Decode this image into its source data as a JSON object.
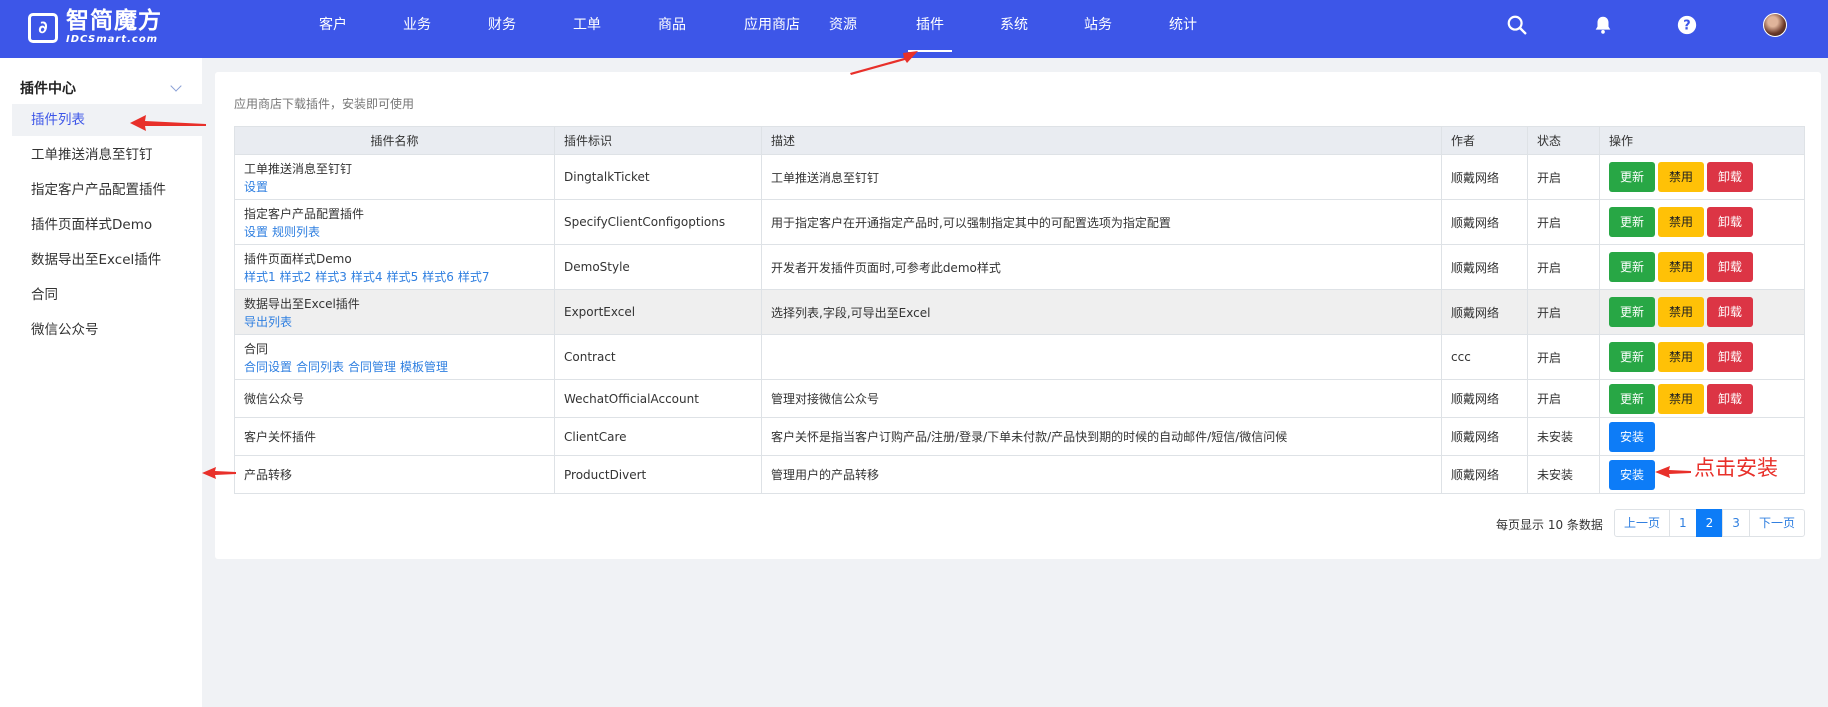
{
  "header": {
    "logo_cn": "智简魔方",
    "logo_en": "IDCSmart.com",
    "nav": [
      {
        "label": "客户"
      },
      {
        "label": "业务"
      },
      {
        "label": "财务"
      },
      {
        "label": "工单"
      },
      {
        "label": "商品"
      },
      {
        "label": "应用商店"
      },
      {
        "label": "资源"
      },
      {
        "label": "插件"
      },
      {
        "label": "系统"
      },
      {
        "label": "站务"
      },
      {
        "label": "统计"
      }
    ],
    "active_nav": "插件",
    "icons": [
      "search-icon",
      "bell-icon",
      "help-icon",
      "user-avatar"
    ]
  },
  "sidebar": {
    "section_title": "插件中心",
    "items": [
      {
        "label": "插件列表"
      },
      {
        "label": "工单推送消息至钉钉"
      },
      {
        "label": "指定客户产品配置插件"
      },
      {
        "label": "插件页面样式Demo"
      },
      {
        "label": "数据导出至Excel插件"
      },
      {
        "label": "合同"
      },
      {
        "label": "微信公众号"
      }
    ],
    "active_item": "插件列表"
  },
  "main": {
    "hint": "应用商店下载插件，安装即可使用",
    "columns": [
      "插件名称",
      "插件标识",
      "描述",
      "作者",
      "状态",
      "操作"
    ],
    "rows": [
      {
        "name": "工单推送消息至钉钉",
        "links": [
          "设置"
        ],
        "id": "DingtalkTicket",
        "desc": "工单推送消息至钉钉",
        "author": "顺戴网络",
        "status": "开启",
        "actions": [
          "更新",
          "禁用",
          "卸载"
        ]
      },
      {
        "name": "指定客户产品配置插件",
        "links": [
          "设置",
          "规则列表"
        ],
        "id": "SpecifyClientConfigoptions",
        "desc": "用于指定客户在开通指定产品时,可以强制指定其中的可配置选项为指定配置",
        "author": "顺戴网络",
        "status": "开启",
        "actions": [
          "更新",
          "禁用",
          "卸载"
        ]
      },
      {
        "name": "插件页面样式Demo",
        "links": [
          "样式1",
          "样式2",
          "样式3",
          "样式4",
          "样式5",
          "样式6",
          "样式7"
        ],
        "id": "DemoStyle",
        "desc": "开发者开发插件页面时,可参考此demo样式",
        "author": "顺戴网络",
        "status": "开启",
        "actions": [
          "更新",
          "禁用",
          "卸载"
        ]
      },
      {
        "name": "数据导出至Excel插件",
        "links": [
          "导出列表"
        ],
        "id": "ExportExcel",
        "desc": "选择列表,字段,可导出至Excel",
        "author": "顺戴网络",
        "status": "开启",
        "actions": [
          "更新",
          "禁用",
          "卸载"
        ]
      },
      {
        "name": "合同",
        "links": [
          "合同设置",
          "合同列表",
          "合同管理",
          "模板管理"
        ],
        "id": "Contract",
        "desc": "",
        "author": "ccc",
        "status": "开启",
        "actions": [
          "更新",
          "禁用",
          "卸载"
        ]
      },
      {
        "name": "微信公众号",
        "links": [],
        "id": "WechatOfficialAccount",
        "desc": "管理对接微信公众号",
        "author": "顺戴网络",
        "status": "开启",
        "actions": [
          "更新",
          "禁用",
          "卸载"
        ]
      },
      {
        "name": "客户关怀插件",
        "links": [],
        "id": "ClientCare",
        "desc": "客户关怀是指当客户订购产品/注册/登录/下单未付款/产品快到期的时候的自动邮件/短信/微信问候",
        "author": "顺戴网络",
        "status": "未安装",
        "actions": [
          "安装"
        ]
      },
      {
        "name": "产品转移",
        "links": [],
        "id": "ProductDivert",
        "desc": "管理用户的产品转移",
        "author": "顺戴网络",
        "status": "未安装",
        "actions": [
          "安装"
        ]
      }
    ],
    "pagination": {
      "per_page_text": "每页显示 10 条数据",
      "prev": "上一页",
      "pages": [
        "1",
        "2",
        "3"
      ],
      "current": "2",
      "next": "下一页"
    }
  },
  "annotation": {
    "text": "点击安装",
    "color": "#e8302a"
  },
  "colors": {
    "header_bg": "#3d56e8",
    "btn_update": "#28a745",
    "btn_disable": "#ffc107",
    "btn_uninstall": "#dc3545",
    "btn_install": "#0d7cf7",
    "link": "#2f7fe0"
  }
}
